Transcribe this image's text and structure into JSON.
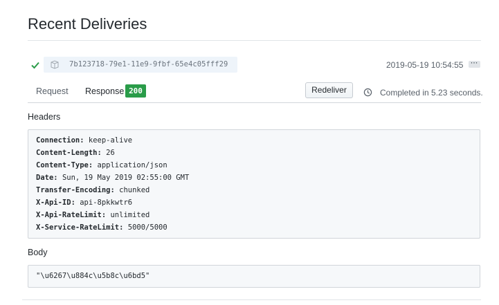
{
  "page": {
    "title": "Recent Deliveries"
  },
  "delivery": {
    "guid": "7b123718-79e1-11e9-9fbf-65e4c05fff29",
    "timestamp": "2019-05-19 10:54:55",
    "more_label": "···",
    "status_icon": "check-icon",
    "guid_icon": "package-icon"
  },
  "tabs": {
    "request_label": "Request",
    "response_label": "Response",
    "status_code": "200",
    "active": "response"
  },
  "actions": {
    "redeliver_label": "Redeliver",
    "completed_text": "Completed in 5.23 seconds."
  },
  "headers_section": {
    "label": "Headers",
    "rows": [
      {
        "key": "Connection:",
        "value": "keep-alive"
      },
      {
        "key": "Content-Length:",
        "value": "26"
      },
      {
        "key": "Content-Type:",
        "value": "application/json"
      },
      {
        "key": "Date:",
        "value": "Sun, 19 May 2019 02:55:00 GMT"
      },
      {
        "key": "Transfer-Encoding:",
        "value": "chunked"
      },
      {
        "key": "X-Api-ID:",
        "value": "api-8pkkwtr6"
      },
      {
        "key": "X-Api-RateLimit:",
        "value": "unlimited"
      },
      {
        "key": "X-Service-RateLimit:",
        "value": "5000/5000"
      }
    ]
  },
  "body_section": {
    "label": "Body",
    "content": "\"\\u6267\\u884c\\u5b8c\\u6bd5\""
  },
  "colors": {
    "success": "#2a9c49",
    "guid_bg": "#eef4fa",
    "code_bg": "#f6f8fa",
    "border": "#d1d5da"
  }
}
